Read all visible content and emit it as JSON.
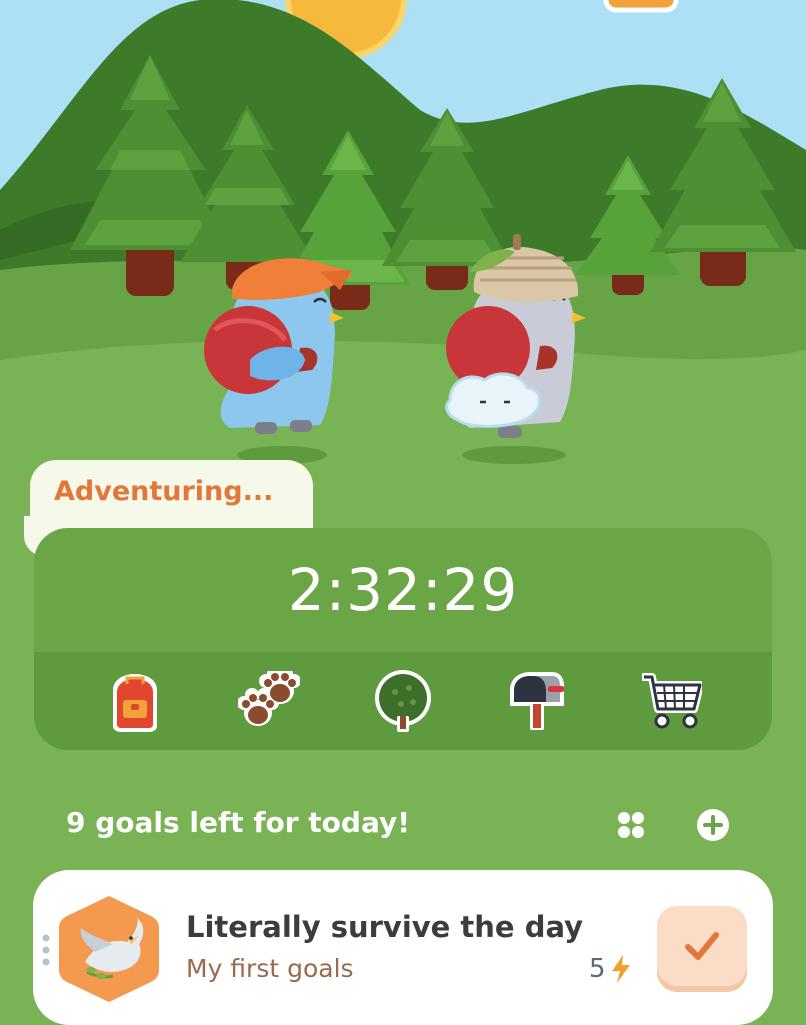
{
  "adventure": {
    "status_label": "Adventuring...",
    "timer": "2:32:29"
  },
  "toolbar": {
    "items": [
      {
        "name": "backpack",
        "icon": "backpack-icon"
      },
      {
        "name": "pets",
        "icon": "paw-prints-icon"
      },
      {
        "name": "tree",
        "icon": "tree-icon"
      },
      {
        "name": "mailbox",
        "icon": "mailbox-icon"
      },
      {
        "name": "shop",
        "icon": "shopping-cart-icon"
      }
    ]
  },
  "goals": {
    "header": "9 goals left for today!",
    "items": [
      {
        "title": "Literally survive the day",
        "subtitle": "My first goals",
        "energy": "5",
        "icon": "dove-icon",
        "badge_color": "#f39a4e"
      }
    ]
  },
  "colors": {
    "sky": "#aee0f5",
    "grass": "#7ab356",
    "card": "#6aa645",
    "accent": "#e2773a"
  }
}
